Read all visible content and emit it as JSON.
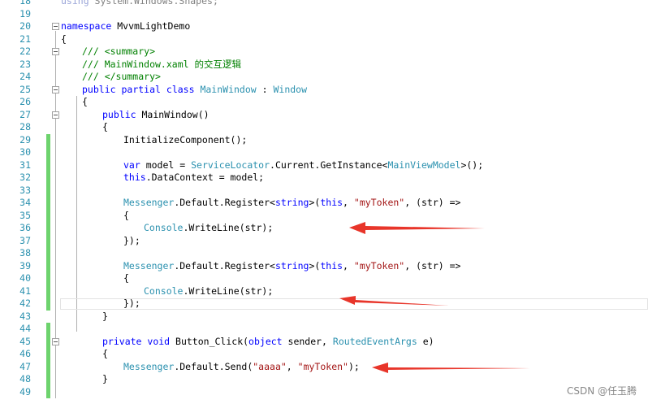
{
  "colors": {
    "line_number": "#2b91af",
    "keyword": "#0000ff",
    "type": "#2b91af",
    "comment": "#008000",
    "string": "#a31515",
    "change_bar": "#6dd36d",
    "arrow": "#e8352a"
  },
  "lines": [
    {
      "n": "18"
    },
    {
      "n": "19"
    },
    {
      "n": "20"
    },
    {
      "n": "21"
    },
    {
      "n": "22"
    },
    {
      "n": "23"
    },
    {
      "n": "24"
    },
    {
      "n": "25"
    },
    {
      "n": "26"
    },
    {
      "n": "27"
    },
    {
      "n": "28"
    },
    {
      "n": "29"
    },
    {
      "n": "30"
    },
    {
      "n": "31"
    },
    {
      "n": "32"
    },
    {
      "n": "33"
    },
    {
      "n": "34"
    },
    {
      "n": "35"
    },
    {
      "n": "36"
    },
    {
      "n": "37"
    },
    {
      "n": "38"
    },
    {
      "n": "39"
    },
    {
      "n": "40"
    },
    {
      "n": "41"
    },
    {
      "n": "42"
    },
    {
      "n": "43"
    },
    {
      "n": "44"
    },
    {
      "n": "45"
    },
    {
      "n": "46"
    },
    {
      "n": "47"
    },
    {
      "n": "48"
    },
    {
      "n": "49"
    }
  ],
  "code": {
    "l18": {
      "kw": "using",
      "rest": " System.Windows.Shapes;"
    },
    "l20": {
      "kw": "namespace",
      "rest": " MvvmLightDemo"
    },
    "l21": "{",
    "l22": "/// <summary>",
    "l23": "/// MainWindow.xaml 的交互逻辑",
    "l24": "/// </summary>",
    "l25": {
      "kw1": "public",
      "kw2": "partial",
      "kw3": "class",
      "name": "MainWindow",
      "sep": " : ",
      "base": "Window"
    },
    "l26": "{",
    "l27": {
      "kw": "public",
      "rest": " MainWindow()"
    },
    "l28": "{",
    "l29": "InitializeComponent();",
    "l31": {
      "kw": "var",
      "a": " model = ",
      "t1": "ServiceLocator",
      "b": ".Current.GetInstance<",
      "t2": "MainViewModel",
      "c": ">();"
    },
    "l32": {
      "kw": "this",
      "rest": ".DataContext = model;"
    },
    "l34": {
      "t": "Messenger",
      "a": ".Default.Register<",
      "kw": "string",
      "b": ">(",
      "kw2": "this",
      "c": ", ",
      "s": "\"myToken\"",
      "d": ", (str) =>"
    },
    "l35": "{",
    "l36": {
      "t": "Console",
      "rest": ".WriteLine(str);"
    },
    "l37": "});",
    "l39": {
      "t": "Messenger",
      "a": ".Default.Register<",
      "kw": "string",
      "b": ">(",
      "kw2": "this",
      "c": ", ",
      "s": "\"myToken\"",
      "d": ", (str) =>"
    },
    "l40": "{",
    "l41": {
      "t": "Console",
      "rest": ".WriteLine(str);"
    },
    "l42": "});",
    "l43": "}",
    "l45": {
      "kw1": "private",
      "kw2": "void",
      "a": " Button_Click(",
      "kw3": "object",
      "b": " sender, ",
      "t": "RoutedEventArgs",
      "c": " e)"
    },
    "l46": "{",
    "l47": {
      "t": "Messenger",
      "a": ".Default.Send(",
      "s1": "\"aaaa\"",
      "b": ", ",
      "s2": "\"myToken\"",
      "c": ");"
    },
    "l48": "}"
  },
  "watermark": "CSDN @任玉腾"
}
